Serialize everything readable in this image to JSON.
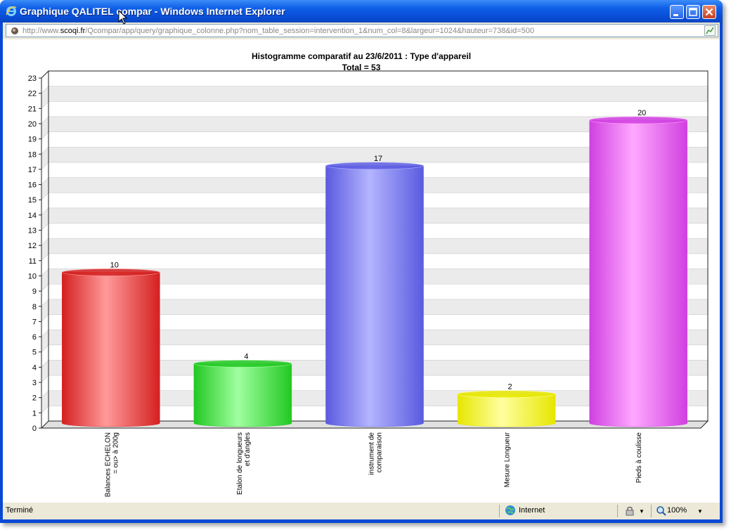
{
  "window": {
    "title": "Graphique QALITEL compar - Windows Internet Explorer"
  },
  "address_bar": {
    "url_prefix": "http://www.",
    "url_domain": "scoqi.fr",
    "url_rest": "/Qcompar/app/query/graphique_colonne.php?nom_table_session=intervention_1&num_col=8&largeur=1024&hauteur=738&id=500"
  },
  "status_bar": {
    "status": "Terminé",
    "zone": "Internet",
    "zoom": "100%"
  },
  "icons": {
    "title": "ie-logo-icon",
    "address": "page-icon",
    "zone": "globe-icon",
    "security": "security-icon",
    "zoom": "zoom-icon"
  },
  "chart_data": {
    "type": "bar",
    "title": "Histogramme comparatif au 23/6/2011 :  Type d'appareil",
    "subtitle": "Total = 53",
    "categories": [
      [
        "Balances ECHELON",
        "= ou> à 200g"
      ],
      [
        "Etalon de longueurs",
        "et d'angles"
      ],
      [
        "instrument de",
        "comparaison"
      ],
      [
        "Mesure Longueur"
      ],
      [
        "Pieds à coulisse"
      ]
    ],
    "values": [
      10,
      4,
      17,
      2,
      20
    ],
    "value_labels": [
      "10",
      "4",
      "17",
      "2",
      "20"
    ],
    "colors": [
      "#d42020",
      "#22c822",
      "#5a5ae0",
      "#e6e600",
      "#d040e0"
    ],
    "highlights": [
      "#ff9a9a",
      "#a0ffa0",
      "#b4b4ff",
      "#ffffa0",
      "#ffa8ff"
    ],
    "ylim": [
      0,
      23
    ],
    "yticks": [
      "0",
      "1",
      "2",
      "3",
      "4",
      "5",
      "6",
      "7",
      "8",
      "9",
      "10",
      "11",
      "12",
      "13",
      "14",
      "15",
      "16",
      "17",
      "18",
      "19",
      "20",
      "21",
      "22",
      "23"
    ],
    "grid": true,
    "bar_style": "3d-cylinder"
  }
}
